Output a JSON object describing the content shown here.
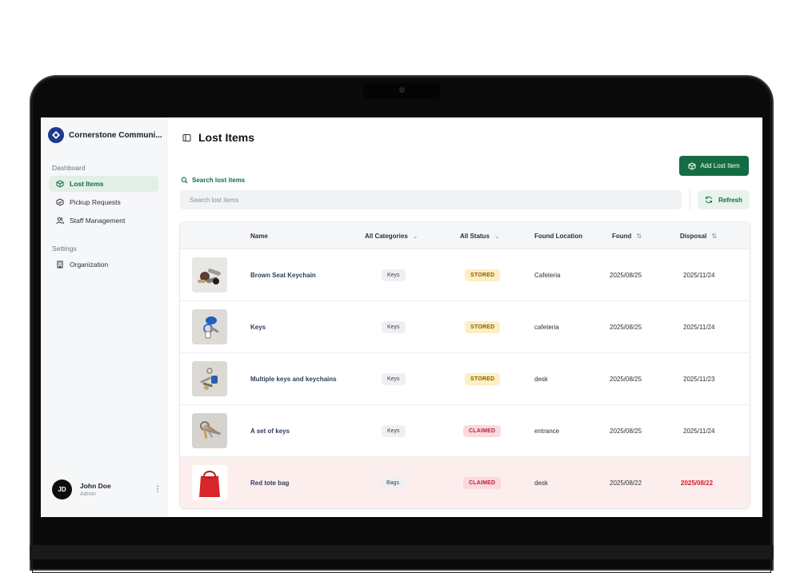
{
  "app": {
    "org_name": "Cornerstone Communi..."
  },
  "sidebar": {
    "groups": [
      {
        "label": "Dashboard",
        "items": [
          {
            "label": "Lost Items",
            "icon": "box-icon",
            "active": true
          },
          {
            "label": "Pickup Requests",
            "icon": "package-check-icon",
            "active": false
          },
          {
            "label": "Staff Management",
            "icon": "users-icon",
            "active": false
          }
        ]
      },
      {
        "label": "Settings",
        "items": [
          {
            "label": "Organization",
            "icon": "building-icon",
            "active": false
          }
        ]
      }
    ],
    "user": {
      "initials": "JD",
      "name": "John Doe",
      "role": "Admin",
      "menu_icon": "more-vertical-icon"
    }
  },
  "header": {
    "title": "Lost Items",
    "toggle_icon": "sidebar-toggle-icon"
  },
  "toolbar": {
    "add_label": "Add Lost Item",
    "refresh_label": "Refresh"
  },
  "search": {
    "label": "Search lost items",
    "placeholder": "Search lost items",
    "value": ""
  },
  "table": {
    "columns": {
      "name": "Name",
      "category": "All Categories",
      "status": "All Status",
      "location": "Found Location",
      "found": "Found",
      "disposal": "Disposal"
    },
    "rows": [
      {
        "name": "Brown Seat Keychain",
        "category": "Keys",
        "status": "STORED",
        "location": "Cafeteria",
        "found": "2025/08/25",
        "disposal": "2025/11/24",
        "thumb": "keys-photo"
      },
      {
        "name": "Keys",
        "category": "Keys",
        "status": "STORED",
        "location": "cafeteria",
        "found": "2025/08/25",
        "disposal": "2025/11/24",
        "thumb": "blue-keychain-photo"
      },
      {
        "name": "Multiple keys and keychains",
        "category": "Keys",
        "status": "STORED",
        "location": "desk",
        "found": "2025/08/25",
        "disposal": "2025/11/23",
        "thumb": "multi-keys-photo"
      },
      {
        "name": "A set of keys",
        "category": "Keys",
        "status": "CLAIMED",
        "location": "entrance",
        "found": "2025/08/25",
        "disposal": "2025/11/24",
        "thumb": "key-set-photo"
      },
      {
        "name": "Red tote bag",
        "category": "Bags",
        "status": "CLAIMED",
        "location": "desk",
        "found": "2025/08/22",
        "disposal": "2025/08/22",
        "thumb": "red-tote-photo"
      }
    ]
  },
  "colors": {
    "accent": "#146c43",
    "stored_bg": "#fcefc2",
    "claimed_bg": "#fbd9dd",
    "overdue": "#d11a2a",
    "highlight_row": "#fdeeee"
  }
}
